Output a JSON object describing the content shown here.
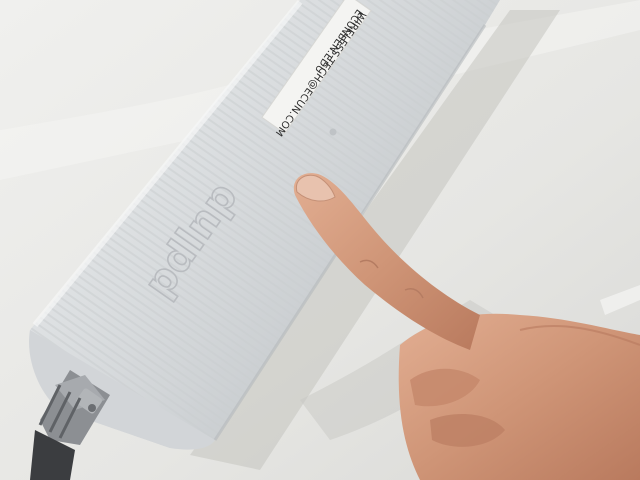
{
  "photo": {
    "subject": "white-ribbed-cylindrical-device",
    "logo_text": "pdlnp",
    "sticker_text_top": "WIRELESS-TECH@ECUN.COM",
    "sticker_text_bottom": "ECUNBEN.EDU",
    "colors": {
      "table": "#e9e9e6",
      "device_body": "#dcdfe1",
      "sticker": "#f4f4f2",
      "skin": "#d29a7e",
      "connector_metal": "#8c8f93"
    }
  }
}
